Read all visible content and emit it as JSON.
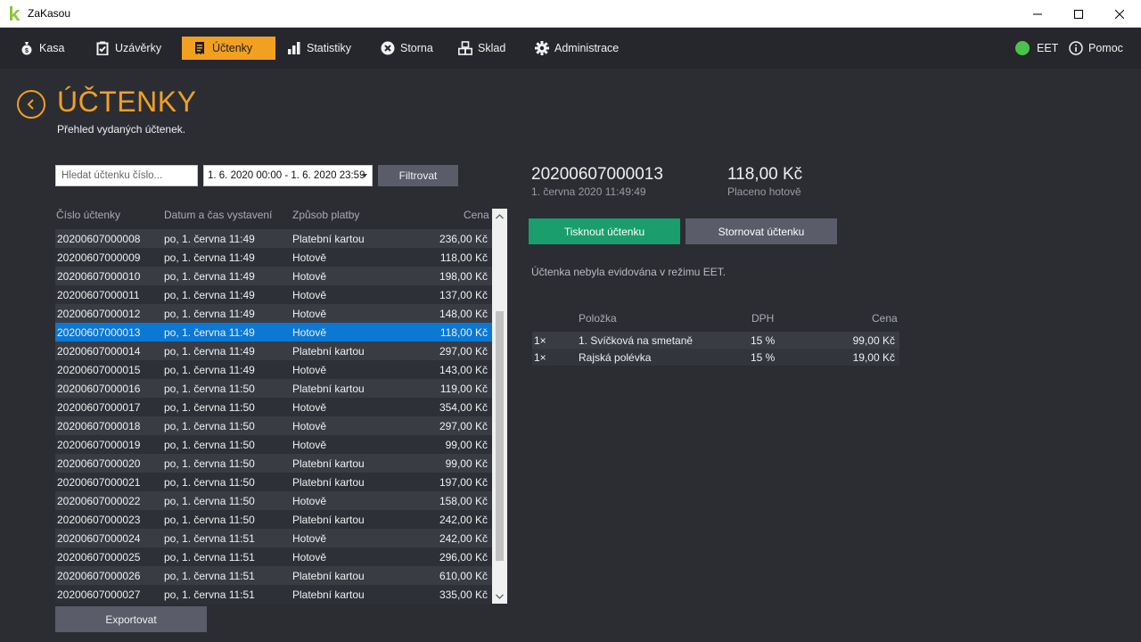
{
  "window": {
    "title": "ZaKasou"
  },
  "nav": {
    "items": [
      {
        "label": "Kasa",
        "icon": "money-bag-icon"
      },
      {
        "label": "Uzávěrky",
        "icon": "clipboard-check-icon"
      },
      {
        "label": "Účtenky",
        "icon": "receipt-icon",
        "active": true
      },
      {
        "label": "Statistiky",
        "icon": "bar-chart-icon"
      },
      {
        "label": "Storna",
        "icon": "x-circle-icon"
      },
      {
        "label": "Sklad",
        "icon": "boxes-icon"
      },
      {
        "label": "Administrace",
        "icon": "gear-icon"
      }
    ],
    "eet_label": "EET",
    "help_label": "Pomoc"
  },
  "header": {
    "title": "ÚČTENKY",
    "subtitle": "Přehled vydaných účtenek."
  },
  "filter": {
    "search_placeholder": "Hledat účtenku číslo...",
    "date_range": "1. 6. 2020 00:00 - 1. 6. 2020 23:59",
    "filter_label": "Filtrovat"
  },
  "table": {
    "columns": [
      "Číslo účtenky",
      "Datum a čas vystavení",
      "Způsob platby",
      "Cena"
    ],
    "rows": [
      [
        "20200607000008",
        "po, 1. června 11:49",
        "Platební kartou",
        "236,00 Kč"
      ],
      [
        "20200607000009",
        "po, 1. června 11:49",
        "Hotově",
        "118,00 Kč"
      ],
      [
        "20200607000010",
        "po, 1. června 11:49",
        "Hotově",
        "198,00 Kč"
      ],
      [
        "20200607000011",
        "po, 1. června 11:49",
        "Hotově",
        "137,00 Kč"
      ],
      [
        "20200607000012",
        "po, 1. června 11:49",
        "Hotově",
        "148,00 Kč"
      ],
      [
        "20200607000013",
        "po, 1. června 11:49",
        "Hotově",
        "118,00 Kč"
      ],
      [
        "20200607000014",
        "po, 1. června 11:49",
        "Platební kartou",
        "297,00 Kč"
      ],
      [
        "20200607000015",
        "po, 1. června 11:49",
        "Hotově",
        "143,00 Kč"
      ],
      [
        "20200607000016",
        "po, 1. června 11:50",
        "Platební kartou",
        "119,00 Kč"
      ],
      [
        "20200607000017",
        "po, 1. června 11:50",
        "Hotově",
        "354,00 Kč"
      ],
      [
        "20200607000018",
        "po, 1. června 11:50",
        "Hotově",
        "297,00 Kč"
      ],
      [
        "20200607000019",
        "po, 1. června 11:50",
        "Hotově",
        "99,00 Kč"
      ],
      [
        "20200607000020",
        "po, 1. června 11:50",
        "Platební kartou",
        "99,00 Kč"
      ],
      [
        "20200607000021",
        "po, 1. června 11:50",
        "Platební kartou",
        "197,00 Kč"
      ],
      [
        "20200607000022",
        "po, 1. června 11:50",
        "Hotově",
        "158,00 Kč"
      ],
      [
        "20200607000023",
        "po, 1. června 11:50",
        "Platební kartou",
        "242,00 Kč"
      ],
      [
        "20200607000024",
        "po, 1. června 11:51",
        "Hotově",
        "242,00 Kč"
      ],
      [
        "20200607000025",
        "po, 1. června 11:51",
        "Hotově",
        "296,00 Kč"
      ],
      [
        "20200607000026",
        "po, 1. června 11:51",
        "Platební kartou",
        "610,00 Kč"
      ],
      [
        "20200607000027",
        "po, 1. června 11:51",
        "Platební kartou",
        "335,00 Kč"
      ]
    ],
    "selected_index": 5,
    "export_label": "Exportovat"
  },
  "detail": {
    "number": "20200607000013",
    "date": "1. června 2020 11:49:49",
    "total": "118,00 Kč",
    "paid": "Placeno hotově",
    "print_label": "Tisknout účtenku",
    "storno_label": "Stornovat účtenku",
    "eet_note": "Účtenka nebyla evidována v režimu EET.",
    "item_columns": [
      "Položka",
      "DPH",
      "Cena"
    ],
    "items": [
      {
        "qty": "1×",
        "name": "1. Svíčková na smetaně",
        "vat": "15 %",
        "price": "99,00 Kč"
      },
      {
        "qty": "1×",
        "name": "Rajská polévka",
        "vat": "15 %",
        "price": "19,00 Kč"
      }
    ]
  },
  "colors": {
    "accent": "#f2a020",
    "selected": "#0b78d4",
    "print": "#1a9e6e",
    "eet": "#4cc24c"
  }
}
